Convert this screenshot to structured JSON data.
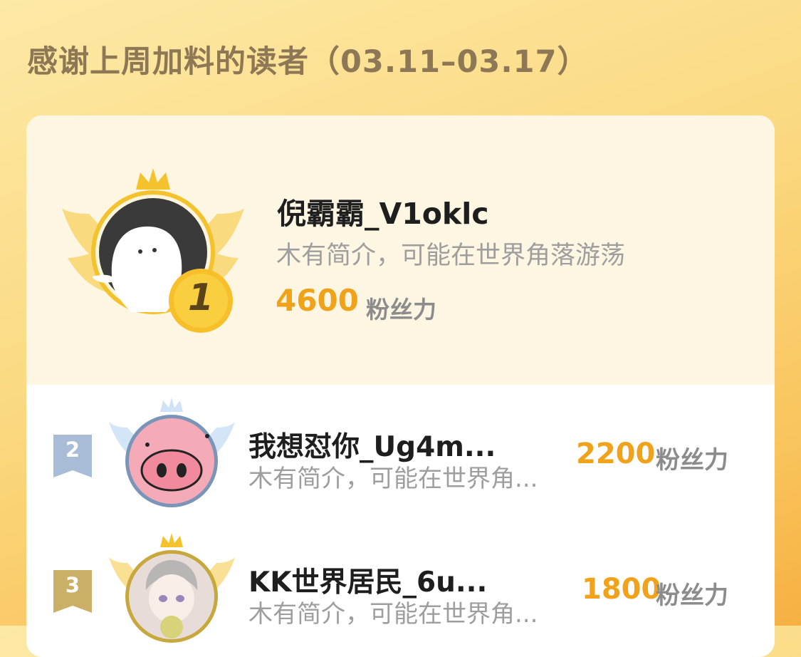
{
  "header": {
    "title": "感谢上周加料的读者（03.11–03.17）"
  },
  "top_reader": {
    "rank": "1",
    "name": "倪霸霸_V1oklc",
    "bio": "木有简介，可能在世界角落游荡",
    "fans_value": "4600",
    "fans_unit": "粉丝力"
  },
  "readers": [
    {
      "rank": "2",
      "name": "我想怼你_Ug4m...",
      "bio": "木有简介，可能在世界角...",
      "fans_value": "2200",
      "fans_unit": "粉丝力"
    },
    {
      "rank": "3",
      "name": "KK世界居民_6u...",
      "bio": "木有简介，可能在世界角...",
      "fans_value": "1800",
      "fans_unit": "粉丝力"
    }
  ],
  "colors": {
    "accent": "#f0a21a",
    "gold": "#f4c22c",
    "silver": "#a8bcd8",
    "bronze": "#c9b066",
    "title": "#8d7755"
  },
  "icons": [
    "crown-icon",
    "wing-icon",
    "rank-medal-icon",
    "rank-ribbon-icon",
    "avatar"
  ]
}
